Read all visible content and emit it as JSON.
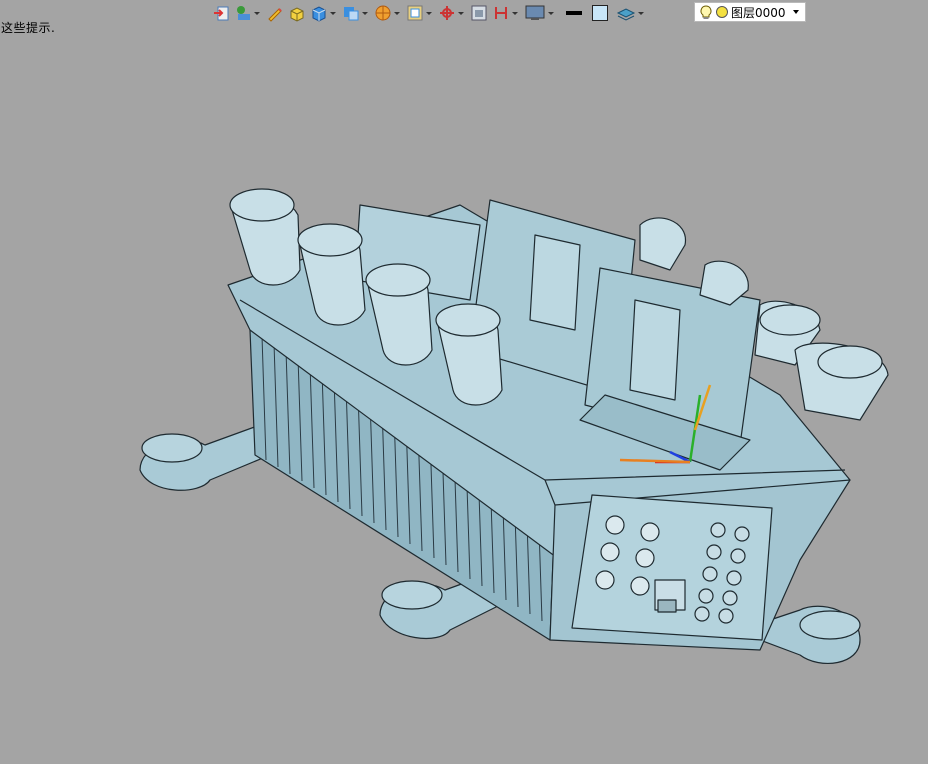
{
  "status": {
    "hint": "这些提示."
  },
  "toolbar": {
    "buttons": [
      {
        "icon": "import-icon",
        "dropdown": false
      },
      {
        "icon": "render-mode-icon",
        "dropdown": true
      },
      {
        "icon": "pencil-icon",
        "dropdown": false
      },
      {
        "icon": "shaded-box-icon",
        "dropdown": false
      },
      {
        "icon": "cube-view-icon",
        "dropdown": true
      },
      {
        "icon": "view-orient-icon",
        "dropdown": true
      },
      {
        "icon": "sphere-display-icon",
        "dropdown": true
      },
      {
        "icon": "frame-icon",
        "dropdown": true
      },
      {
        "icon": "axis-icon",
        "dropdown": true
      },
      {
        "icon": "window-icon",
        "dropdown": false
      },
      {
        "icon": "section-icon",
        "dropdown": true
      },
      {
        "icon": "monitor-icon",
        "dropdown": true
      }
    ],
    "line_color": "#000000",
    "fill_color": "#c8e6f8",
    "layer_select": {
      "value": "图层0000"
    }
  },
  "model": {
    "color": "#9fc3cf",
    "edge_color": "#1e2a30"
  }
}
